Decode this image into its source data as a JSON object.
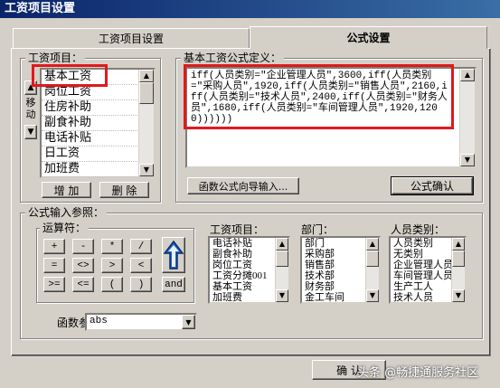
{
  "window": {
    "title": "工资项目设置"
  },
  "tabs": [
    {
      "label": "工资项目设置"
    },
    {
      "label": "公式设置"
    }
  ],
  "salary_items_group": {
    "label": "工资项目：",
    "items": [
      "基本工资",
      "岗位工资",
      "住房补助",
      "副食补助",
      "电话补贴",
      "日工资",
      "加班费"
    ],
    "move_label": "移动",
    "add_button": "增 加",
    "delete_button": "删 除"
  },
  "formula_group": {
    "label": "基本工资公式定义：",
    "formula": "iff(人员类别=\"企业管理人员\",3600,iff(人员类别=\"采购人员\",1920,iff(人员类别=\"销售人员\",2160,iff(人员类别=\"技术人员\",2400,iff(人员类别=\"财务人员\",1680,iff(人员类别=\"车间管理人员\",1920,1200))))))",
    "wizard_button": "函数公式向导输入...",
    "confirm_button": "公式确认"
  },
  "input_ref_group": {
    "label": "公式输入参照：",
    "operators_label": "运算符：",
    "operators": [
      "+",
      "-",
      "*",
      "/",
      "=",
      "<>",
      ">",
      "<",
      ">=",
      "<=",
      "(",
      ")",
      "and"
    ],
    "salary_items_label": "工资项目：",
    "salary_items": [
      "电话补贴",
      "副食补助",
      "岗位工资",
      "工资分摊001",
      "基本工资",
      "加班费"
    ],
    "dept_label": "部门：",
    "departments": [
      "部门",
      "采购部",
      "销售部",
      "技术部",
      "财务部",
      "金工车间"
    ],
    "category_label": "人员类别：",
    "categories": [
      "人员类别",
      "无类别",
      "企业管理人员",
      "车间管理人员",
      "生产工人",
      "技术人员"
    ],
    "function_label": "函数参照：",
    "function_value": "abs"
  },
  "footer": {
    "ok_button": "确 认",
    "watermark": "头条 @畅捷通服务社区"
  }
}
